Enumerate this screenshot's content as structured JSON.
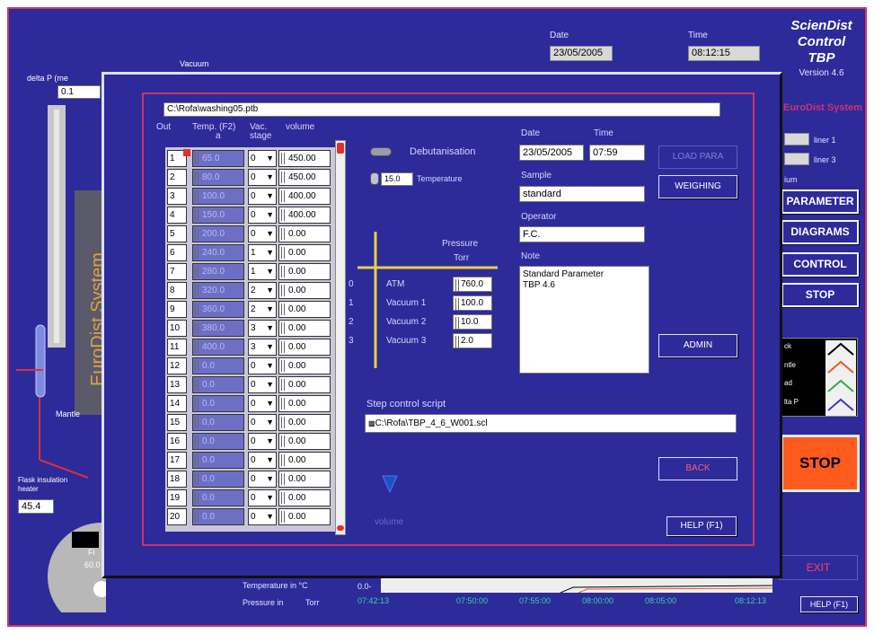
{
  "background": {
    "date_label": "Date",
    "date_value": "23/05/2005",
    "time_label": "Time",
    "time_value": "08:12:15",
    "app_title_lines": [
      "ScienDist",
      "Control",
      "TBP"
    ],
    "version": "Version 4.6",
    "brand": "EuroDist System",
    "vacuum_label": "Vacuum",
    "delta_p_label": "delta P (me",
    "delta_p_value": "0.1",
    "vertical_brand": "EuroDist System",
    "mantle_label": "Mantle",
    "flask_label": "Flask insulation heater",
    "flask_value": "45.4",
    "flask_box_label": "Fl",
    "flask_box_value": "60.0",
    "liner1": "liner 1",
    "liner3": "liner 3",
    "ium": "ium",
    "menu_buttons": [
      "PARAMETER",
      "DIAGRAMS",
      "CONTROL",
      "STOP"
    ],
    "legend": [
      "ck",
      "ntle",
      "ad",
      "lta P"
    ],
    "big_stop": "STOP",
    "exit": "EXIT",
    "help": "HELP (F1)",
    "temp_unit": "Temperature in °C",
    "pressure_unit_label": "Pressure in",
    "pressure_unit": "Torr",
    "y_axis_zero": "0.0-",
    "x_ticks": [
      "07:42:13",
      "07:50:00",
      "07:55:00",
      "08:00:00",
      "08:05:00",
      "08:12:13"
    ]
  },
  "dialog": {
    "file_path": "C:\\Rofa\\washing05.ptb",
    "col_out": "Out",
    "col_temp": "Temp. (F2)",
    "col_temp_sub": "a",
    "col_vac": "Vac.",
    "col_vac_sub": "stage",
    "col_volume": "volume",
    "rows": [
      {
        "out": "1",
        "temp": "65.0",
        "stage": "0",
        "vol": "450.00"
      },
      {
        "out": "2",
        "temp": "80.0",
        "stage": "0",
        "vol": "450.00"
      },
      {
        "out": "3",
        "temp": "100.0",
        "stage": "0",
        "vol": "400.00"
      },
      {
        "out": "4",
        "temp": "150.0",
        "stage": "0",
        "vol": "400.00"
      },
      {
        "out": "5",
        "temp": "200.0",
        "stage": "0",
        "vol": "0.00"
      },
      {
        "out": "6",
        "temp": "240.0",
        "stage": "1",
        "vol": "0.00"
      },
      {
        "out": "7",
        "temp": "280.0",
        "stage": "1",
        "vol": "0.00"
      },
      {
        "out": "8",
        "temp": "320.0",
        "stage": "2",
        "vol": "0.00"
      },
      {
        "out": "9",
        "temp": "360.0",
        "stage": "2",
        "vol": "0.00"
      },
      {
        "out": "10",
        "temp": "380.0",
        "stage": "3",
        "vol": "0.00"
      },
      {
        "out": "11",
        "temp": "400.0",
        "stage": "3",
        "vol": "0.00"
      },
      {
        "out": "12",
        "temp": "0.0",
        "stage": "0",
        "vol": "0.00"
      },
      {
        "out": "13",
        "temp": "0.0",
        "stage": "0",
        "vol": "0.00"
      },
      {
        "out": "14",
        "temp": "0.0",
        "stage": "0",
        "vol": "0.00"
      },
      {
        "out": "15",
        "temp": "0.0",
        "stage": "0",
        "vol": "0.00"
      },
      {
        "out": "16",
        "temp": "0.0",
        "stage": "0",
        "vol": "0.00"
      },
      {
        "out": "17",
        "temp": "0.0",
        "stage": "0",
        "vol": "0.00"
      },
      {
        "out": "18",
        "temp": "0.0",
        "stage": "0",
        "vol": "0.00"
      },
      {
        "out": "19",
        "temp": "0.0",
        "stage": "0",
        "vol": "0.00"
      },
      {
        "out": "20",
        "temp": "0.0",
        "stage": "0",
        "vol": "0.00"
      }
    ],
    "debutanisation_label": "Debutanisation",
    "temperature_value": "15.0",
    "temperature_label": "Temperature",
    "pressure_header": "Pressure",
    "pressure_unit": "Torr",
    "pressure_rows": [
      {
        "idx": "0",
        "label": "ATM",
        "value": "760.0"
      },
      {
        "idx": "1",
        "label": "Vacuum 1",
        "value": "100.0"
      },
      {
        "idx": "2",
        "label": "Vacuum 2",
        "value": "10.0"
      },
      {
        "idx": "3",
        "label": "Vacuum 3",
        "value": "2.0"
      }
    ],
    "date_label": "Date",
    "date_value": "23/05/2005",
    "time_label": "Time",
    "time_value": "07:59",
    "sample_label": "Sample",
    "sample_value": "standard",
    "operator_label": "Operator",
    "operator_value": "F.C.",
    "note_label": "Note",
    "note_line1": "Standard Parameter",
    "note_line2": "TBP 4.6",
    "load_para": "LOAD PARA",
    "weighing": "WEIGHING",
    "admin": "ADMIN",
    "step_label": "Step control script",
    "step_value": "C:\\Rofa\\TBP_4_6_W001.scl",
    "back": "BACK",
    "help": "HELP (F1)",
    "volume_label": "volume"
  }
}
